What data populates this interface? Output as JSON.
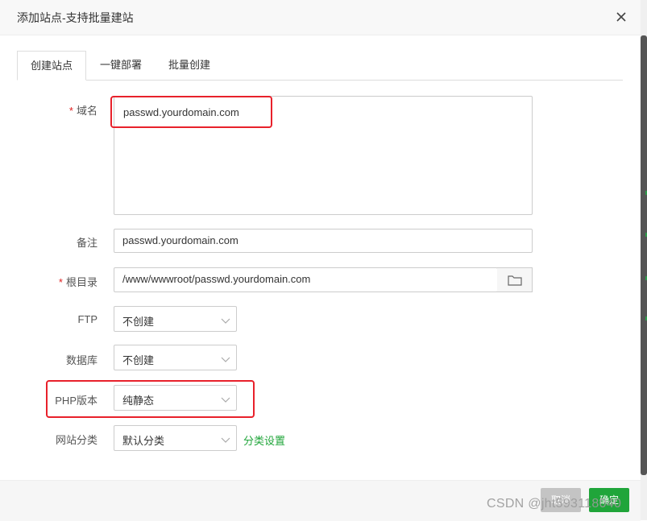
{
  "dialog": {
    "title": "添加站点-支持批量建站"
  },
  "tabs": [
    {
      "label": "创建站点",
      "active": true
    },
    {
      "label": "一键部署",
      "active": false
    },
    {
      "label": "批量创建",
      "active": false
    }
  ],
  "form": {
    "domain": {
      "required_mark": "*",
      "label": "域名",
      "value": "passwd.yourdomain.com"
    },
    "remark": {
      "label": "备注",
      "value": "passwd.yourdomain.com"
    },
    "root": {
      "required_mark": "*",
      "label": "根目录",
      "value": "/www/wwwroot/passwd.yourdomain.com"
    },
    "ftp": {
      "label": "FTP",
      "value": "不创建"
    },
    "database": {
      "label": "数据库",
      "value": "不创建"
    },
    "php": {
      "label": "PHP版本",
      "value": "纯静态"
    },
    "category": {
      "label": "网站分类",
      "value": "默认分类",
      "link": "分类设置"
    }
  },
  "footer": {
    "cancel_label": "取消",
    "ok_label": "确定"
  },
  "watermark": "CSDN @jht593118040",
  "colors": {
    "accent": "#20a53a",
    "required": "#e02020",
    "highlight": "#e8212b"
  }
}
